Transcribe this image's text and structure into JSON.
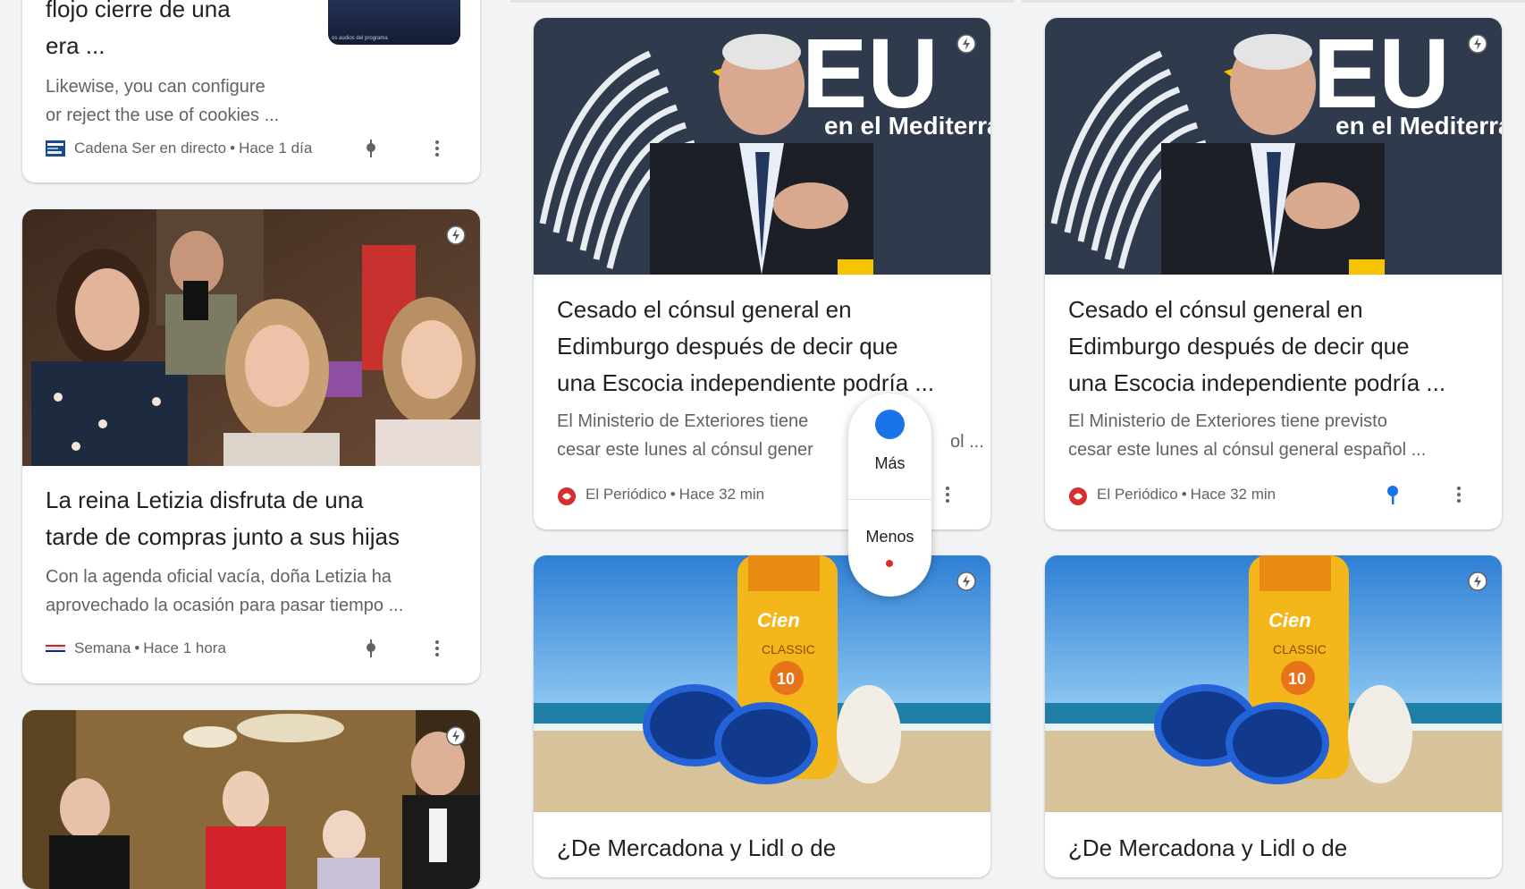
{
  "column1": {
    "card_top": {
      "title_lines": [
        "flojo cierre de una",
        "era ..."
      ],
      "snippet_lines": [
        "Likewise, you can configure",
        "or reject the use of cookies ..."
      ],
      "source": "Cadena Ser en directo",
      "time": "Hace 1 día",
      "thumbnail_caption": "os audios del programa"
    },
    "card_letizia": {
      "title_lines": [
        "La reina Letizia disfruta de una",
        "tarde de compras junto a sus hijas"
      ],
      "snippet_lines": [
        "Con la agenda oficial vacía, doña Letizia ha",
        "aprovechado la ocasión para pasar tiempo ..."
      ],
      "source": "Semana",
      "time": "Hace 1 hora"
    }
  },
  "column2": {
    "card_consul": {
      "image_sign": "EU",
      "image_subtitle": "en el Mediterrá",
      "title_lines": [
        "Cesado el cónsul general en",
        "Edimburgo después de decir que",
        "una Escocia independiente podría ..."
      ],
      "snippet_lines": [
        "El Ministerio de Exteriores tiene",
        "cesar este lunes al cónsul gener"
      ],
      "snippet_tail": "ol ...",
      "source": "El Periódico",
      "time": "Hace 32 min"
    },
    "card_mercadona": {
      "bottle_brand": "Cien",
      "bottle_label": "CLASSIC",
      "bottle_spf": "10",
      "title_line": "¿De Mercadona y Lidl o de"
    }
  },
  "column3": {
    "card_consul": {
      "image_sign": "EU",
      "image_subtitle": "en el Mediterrá",
      "title_lines": [
        "Cesado el cónsul general en",
        "Edimburgo después de decir que",
        "una Escocia independiente podría ..."
      ],
      "snippet_lines": [
        "El Ministerio de Exteriores tiene previsto",
        "cesar este lunes al cónsul general español ..."
      ],
      "source": "El Periódico",
      "time": "Hace 32 min"
    },
    "card_mercadona": {
      "bottle_brand": "Cien",
      "bottle_label": "CLASSIC",
      "bottle_spf": "10",
      "title_line": "¿De Mercadona y Lidl o de"
    }
  },
  "popup": {
    "more_label": "Más",
    "less_label": "Menos"
  },
  "colors": {
    "background": "#f1f3f4",
    "accent_blue": "#1a73e8",
    "accent_red": "#d93025",
    "text_primary": "#202124",
    "text_secondary": "#5f6368"
  },
  "icons": [
    "amp-bolt-icon",
    "pin-icon",
    "more-vert-icon",
    "source-logo-icon"
  ]
}
